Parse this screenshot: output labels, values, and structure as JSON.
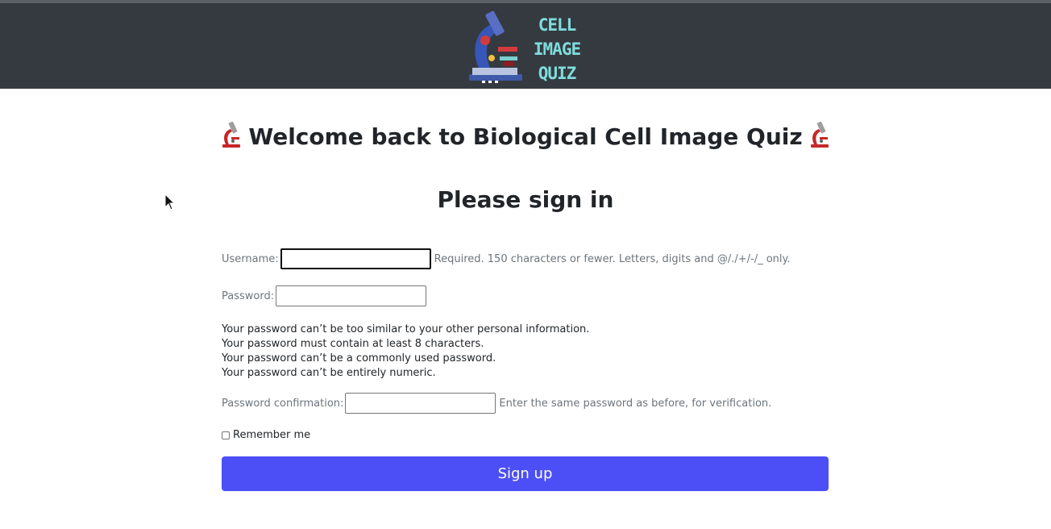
{
  "header": {
    "logo_lines": [
      "CELL",
      "IMAGE",
      "QUIZ"
    ],
    "logo_icon": "microscope-logo-icon",
    "background": "#343a40",
    "logo_text_color": "#7fdcdc"
  },
  "page": {
    "title": "Welcome back to Biological Cell Image Quiz",
    "title_icon": "microscope-emoji-icon",
    "subtitle": "Please sign in"
  },
  "form": {
    "username_label": "Username:",
    "username_value": "",
    "username_help": "Required. 150 characters or fewer. Letters, digits and @/./+/-/_ only.",
    "password_label": "Password:",
    "password_value": "",
    "password_rules": [
      "Your password can’t be too similar to your other personal information.",
      "Your password must contain at least 8 characters.",
      "Your password can’t be a commonly used password.",
      "Your password can’t be entirely numeric."
    ],
    "confirm_label": "Password confirmation:",
    "confirm_value": "",
    "confirm_help": "Enter the same password as before, for verification.",
    "remember_label": "Remember me",
    "remember_checked": false,
    "submit_label": "Sign up",
    "accent_color": "#4b4ff5"
  }
}
